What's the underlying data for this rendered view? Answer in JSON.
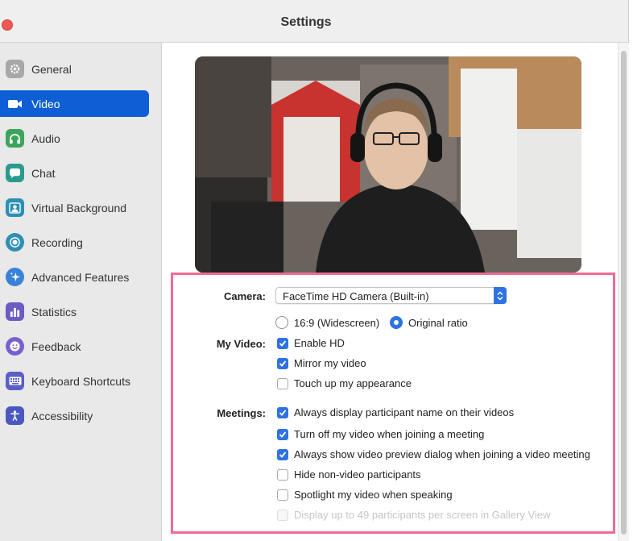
{
  "window": {
    "title": "Settings"
  },
  "sidebar": {
    "items": [
      {
        "label": "General",
        "icon": "gear-icon",
        "color": "#9a9a9a",
        "active": false
      },
      {
        "label": "Video",
        "icon": "video-camera-icon",
        "color": "#ffffff",
        "active": true
      },
      {
        "label": "Audio",
        "icon": "headphones-icon",
        "color": "#3ba55c",
        "active": false
      },
      {
        "label": "Chat",
        "icon": "chat-bubble-icon",
        "color": "#2b9a8c",
        "active": false
      },
      {
        "label": "Virtual Background",
        "icon": "person-background-icon",
        "color": "#2e8fb5",
        "active": false
      },
      {
        "label": "Recording",
        "icon": "record-icon",
        "color": "#2e8fb5",
        "active": false
      },
      {
        "label": "Advanced Features",
        "icon": "sparkles-icon",
        "color": "#3b82d6",
        "active": false
      },
      {
        "label": "Statistics",
        "icon": "bar-chart-icon",
        "color": "#6b5bc5",
        "active": false
      },
      {
        "label": "Feedback",
        "icon": "smiley-icon",
        "color": "#7a5fd0",
        "active": false
      },
      {
        "label": "Keyboard Shortcuts",
        "icon": "keyboard-icon",
        "color": "#5b5fc5",
        "active": false
      },
      {
        "label": "Accessibility",
        "icon": "accessibility-icon",
        "color": "#4a57c0",
        "active": false
      }
    ]
  },
  "video": {
    "camera_label": "Camera:",
    "camera_value": "FaceTime HD Camera (Built-in)",
    "ratio_widescreen": "16:9 (Widescreen)",
    "ratio_original": "Original ratio",
    "ratio_selected": "Original ratio",
    "my_video_label": "My Video:",
    "enable_hd": "Enable HD",
    "mirror_video": "Mirror my video",
    "touch_up": "Touch up my appearance",
    "meetings_label": "Meetings:",
    "display_names": "Always display participant name on their videos",
    "turn_off_video": "Turn off my video when joining a meeting",
    "show_preview": "Always show video preview dialog when joining a video meeting",
    "hide_non_video": "Hide non-video participants",
    "spotlight": "Spotlight my video when speaking",
    "gallery_49": "Display up to 49 participants per screen in Gallery View"
  },
  "colors": {
    "accent": "#2f73e3",
    "sidebar_active": "#0e5fd6",
    "highlight_border": "#f06b92"
  }
}
